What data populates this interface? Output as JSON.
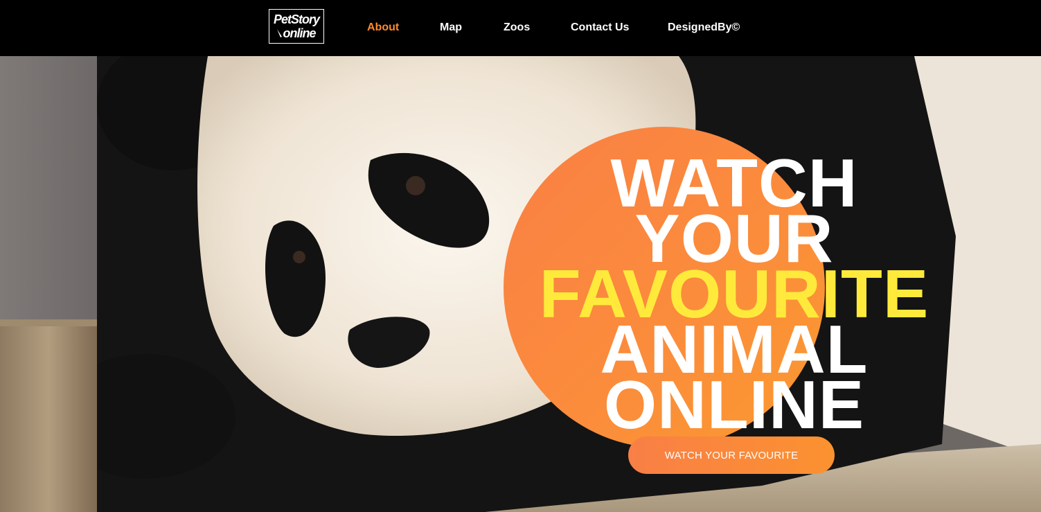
{
  "brand": {
    "logo_line1": "PetStory",
    "logo_line2": "online"
  },
  "nav": {
    "items": [
      {
        "label": "About",
        "active": true
      },
      {
        "label": "Map",
        "active": false
      },
      {
        "label": "Zoos",
        "active": false
      },
      {
        "label": "Contact Us",
        "active": false
      },
      {
        "label": "DesignedBy©",
        "active": false
      }
    ]
  },
  "hero": {
    "headline": {
      "line1": "WATCH",
      "line2": "YOUR",
      "line3": "FAVOURITE",
      "line4": "ANIMAL",
      "line5": "ONLINE"
    },
    "cta_label": "WATCH YOUR FAVOURITE"
  },
  "colors": {
    "nav_background": "#000000",
    "nav_active": "#fb8c2c",
    "circle_accent": "#fa7f45",
    "highlight_text": "#ffea3b",
    "button_gradient_start": "#f97f46",
    "button_gradient_end": "#fb9230"
  }
}
